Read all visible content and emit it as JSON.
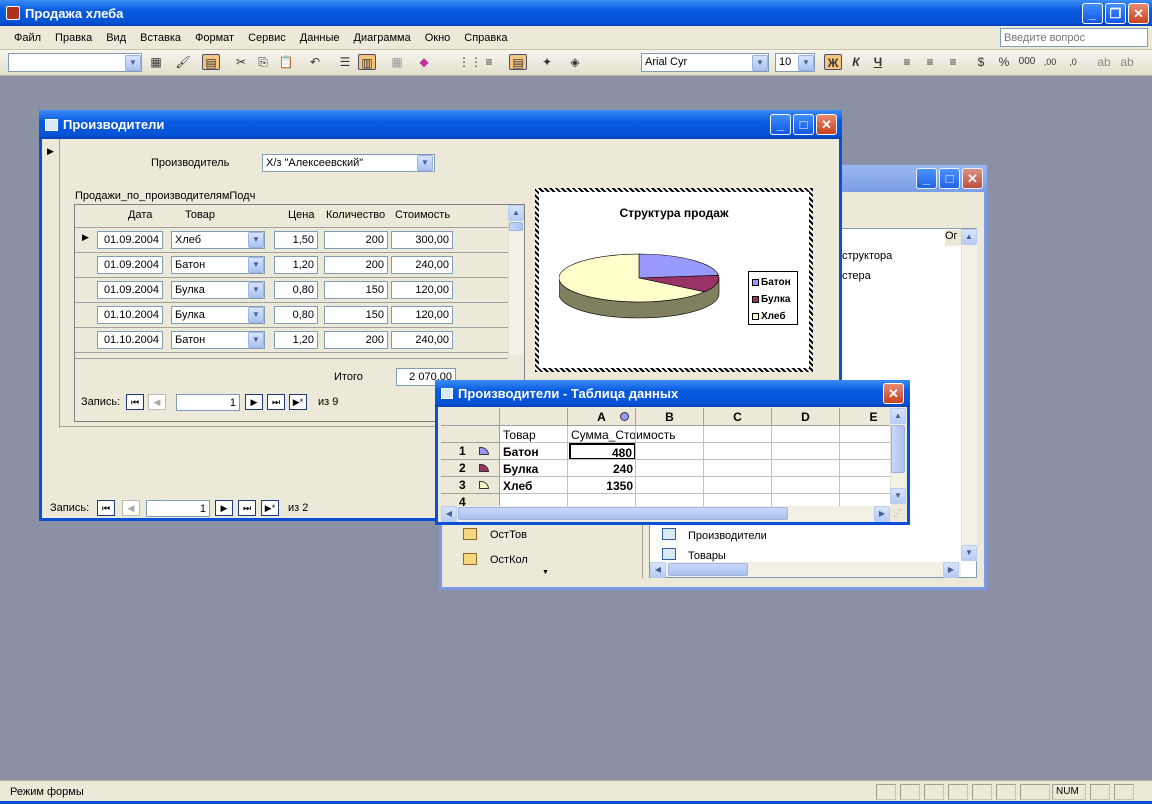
{
  "app": {
    "title": "Продажа хлеба"
  },
  "menu": [
    "Файл",
    "Правка",
    "Вид",
    "Вставка",
    "Формат",
    "Сервис",
    "Данные",
    "Диаграмма",
    "Окно",
    "Справка"
  ],
  "help_box": {
    "placeholder": "Введите вопрос"
  },
  "format_toolbar": {
    "font": "Arial Cyr",
    "size": "10",
    "bold": "Ж",
    "italic": "К",
    "underline": "Ч"
  },
  "db_window": {
    "col_header": "Ог",
    "items_right": [
      "структора",
      "стера"
    ],
    "items_bottom_right": [
      "Производители",
      "Товары"
    ],
    "items_left": [
      "ОстТов",
      "ОстКол"
    ]
  },
  "form": {
    "title": "Производители",
    "producer_label": "Производитель",
    "producer_value": "Х/з \"Алексеевский\"",
    "subform_label": "Продажи_по_производителямПодч",
    "columns": [
      "Дата",
      "Товар",
      "Цена",
      "Количество",
      "Стоимость"
    ],
    "rows": [
      {
        "date": "01.09.2004",
        "item": "Хлеб",
        "price": "1,50",
        "qty": "200",
        "cost": "300,00"
      },
      {
        "date": "01.09.2004",
        "item": "Батон",
        "price": "1,20",
        "qty": "200",
        "cost": "240,00"
      },
      {
        "date": "01.09.2004",
        "item": "Булка",
        "price": "0,80",
        "qty": "150",
        "cost": "120,00"
      },
      {
        "date": "01.10.2004",
        "item": "Булка",
        "price": "0,80",
        "qty": "150",
        "cost": "120,00"
      },
      {
        "date": "01.10.2004",
        "item": "Батон",
        "price": "1,20",
        "qty": "200",
        "cost": "240,00"
      }
    ],
    "total_label": "Итого",
    "total_value": "2 070,00",
    "sub_nav": {
      "label": "Запись:",
      "current": "1",
      "of": "из 9"
    },
    "main_nav": {
      "label": "Запись:",
      "current": "1",
      "of": "из 2"
    }
  },
  "chart": {
    "title": "Структура продаж",
    "legend": [
      "Батон",
      "Булка",
      "Хлеб"
    ],
    "colors": [
      "#9999ff",
      "#993366",
      "#ffffcc"
    ]
  },
  "chart_data": {
    "type": "pie",
    "title": "Структура продаж",
    "categories": [
      "Батон",
      "Булка",
      "Хлеб"
    ],
    "values": [
      480,
      240,
      1350
    ],
    "legend": "right"
  },
  "datasheet": {
    "title": "Производители - Таблица данных",
    "col_letters": [
      "A",
      "B",
      "C",
      "D",
      "E"
    ],
    "header_row": {
      "c0": "Товар",
      "c1": "Сумма_Стоимость"
    },
    "rows": [
      {
        "n": "1",
        "name": "Батон",
        "value": "480"
      },
      {
        "n": "2",
        "name": "Булка",
        "value": "240"
      },
      {
        "n": "3",
        "name": "Хлеб",
        "value": "1350"
      },
      {
        "n": "4",
        "name": "",
        "value": ""
      }
    ]
  },
  "status": {
    "text": "Режим формы",
    "num": "NUM"
  }
}
